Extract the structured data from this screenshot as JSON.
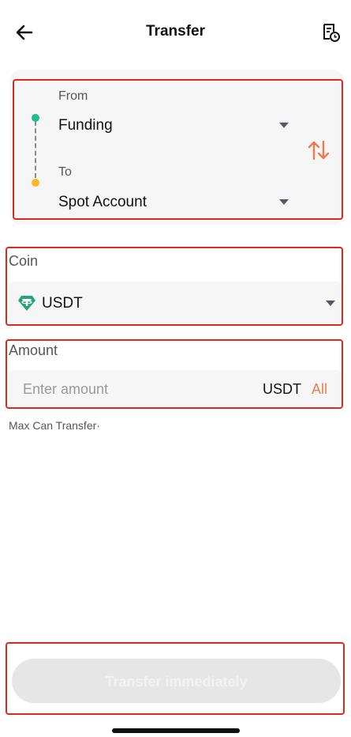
{
  "header": {
    "title": "Transfer",
    "back_icon": "arrow-left-icon",
    "history_icon": "transfer-history-icon"
  },
  "from_to": {
    "from_label": "From",
    "from_value": "Funding",
    "to_label": "To",
    "to_value": "Spot Account",
    "swap_icon": "swap-vertical-icon"
  },
  "coin": {
    "label": "Coin",
    "value": "USDT",
    "icon": "tether-icon"
  },
  "amount": {
    "label": "Amount",
    "placeholder": "Enter amount",
    "unit": "USDT",
    "all_label": "All"
  },
  "max_transfer_label": "Max Can Transfer·",
  "submit_label": "Transfer immediately",
  "colors": {
    "accent": "#f07a4e",
    "from_dot": "#1ebf8e",
    "to_dot": "#f7b924",
    "tether": "#26a17b",
    "highlight": "#e0261d",
    "disabled_button": "#e6e6e6"
  }
}
